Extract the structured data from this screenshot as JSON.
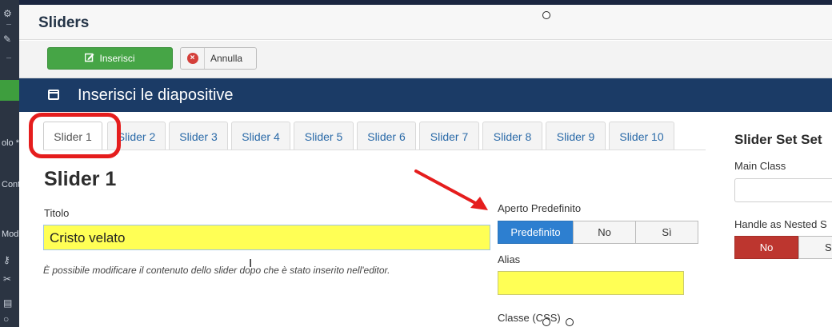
{
  "window": {
    "title": "Sliders"
  },
  "left_menu": {
    "fragments": [
      "olo *",
      "Cont",
      "Mod"
    ]
  },
  "toolbar": {
    "insert_label": "Inserisci",
    "cancel_label": "Annulla"
  },
  "banner": {
    "title": "Inserisci le diapositive"
  },
  "tabs": [
    "Slider 1",
    "Slider 2",
    "Slider 3",
    "Slider 4",
    "Slider 5",
    "Slider 6",
    "Slider 7",
    "Slider 8",
    "Slider 9",
    "Slider 10"
  ],
  "active_tab": "Slider 1",
  "form": {
    "heading": "Slider 1",
    "title_label": "Titolo",
    "title_value": "Cristo velato",
    "help_text": "È possibile modificare il contenuto dello slider dopo che è stato inserito nell'editor.",
    "default_open_label": "Aperto Predefinito",
    "default_open_options": [
      "Predefinito",
      "No",
      "Sì"
    ],
    "default_open_selected": "Predefinito",
    "alias_label": "Alias",
    "alias_value": "",
    "css_class_label": "Classe (CSS)"
  },
  "settings_panel": {
    "title": "Slider Set Set",
    "main_class_label": "Main Class",
    "main_class_value": "",
    "nested_label": "Handle as Nested S",
    "nested_options": [
      "No",
      "S"
    ],
    "nested_selected": "No"
  },
  "colors": {
    "accent_blue": "#2d7fd0",
    "banner": "#1b3b66",
    "insert_green": "#46a546",
    "highlight_yellow": "#ffff55",
    "annotation_red": "#e51d1d",
    "no_red": "#bd362f"
  }
}
